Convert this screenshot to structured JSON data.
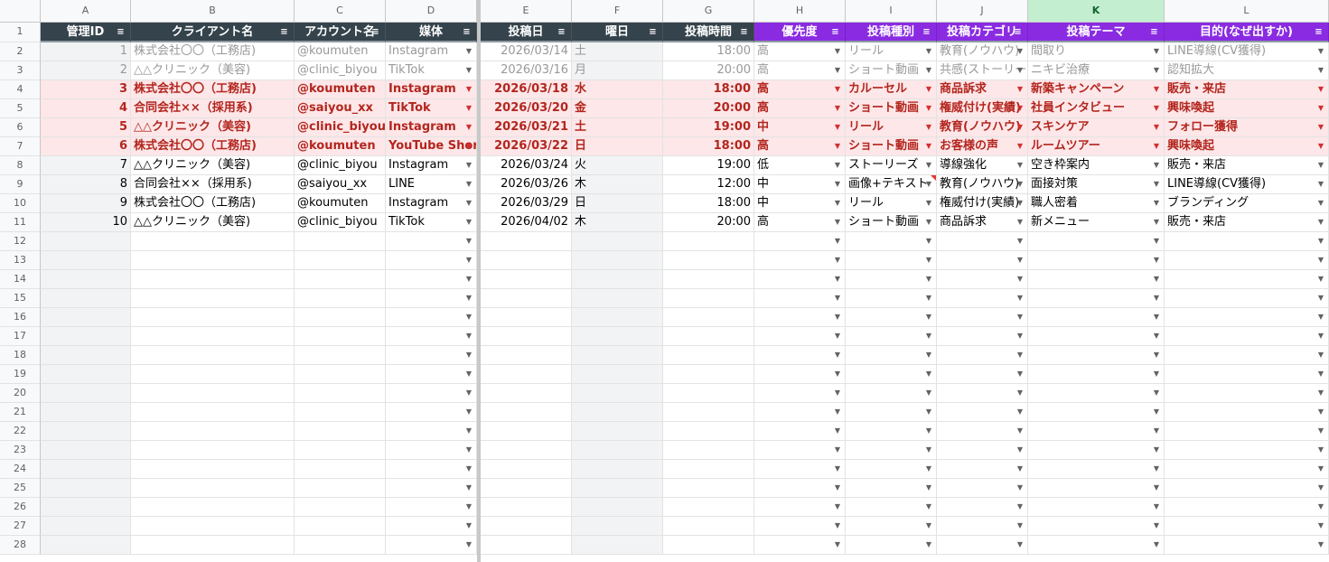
{
  "columns": [
    "A",
    "B",
    "C",
    "D",
    "E",
    "F",
    "G",
    "H",
    "I",
    "J",
    "K",
    "L"
  ],
  "headers": [
    "管理ID",
    "クライアント名",
    "アカウント名",
    "媒体",
    "投稿日",
    "曜日",
    "投稿時間",
    "優先度",
    "投稿種別",
    "投稿カテゴリ",
    "投稿テーマ",
    "目的(なぜ出すか)"
  ],
  "row_numbers": [
    "1",
    "2",
    "3",
    "4",
    "5",
    "6",
    "7",
    "8",
    "9",
    "10",
    "11",
    "12",
    "13",
    "14",
    "15",
    "16",
    "17",
    "18",
    "19",
    "20",
    "21",
    "22",
    "23",
    "24",
    "25",
    "26",
    "27",
    "28"
  ],
  "rows": [
    {
      "style": "gray",
      "cells": [
        "1",
        "株式会社〇〇（工務店)",
        "@koumuten",
        "Instagram",
        "2026/03/14",
        "土",
        "18:00",
        "高",
        "リール",
        "教育(ノウハウ)",
        "間取り",
        "LINE導線(CV獲得)"
      ]
    },
    {
      "style": "gray",
      "cells": [
        "2",
        "△△クリニック（美容)",
        "@clinic_biyou",
        "TikTok",
        "2026/03/16",
        "月",
        "20:00",
        "高",
        "ショート動画",
        "共感(ストーリー)",
        "ニキビ治療",
        "認知拡大"
      ]
    },
    {
      "style": "red",
      "cells": [
        "3",
        "株式会社〇〇（工務店)",
        "@koumuten",
        "Instagram",
        "2026/03/18",
        "水",
        "18:00",
        "高",
        "カルーセル",
        "商品訴求",
        "新築キャンペーン",
        "販売・来店"
      ]
    },
    {
      "style": "red",
      "cells": [
        "4",
        "合同会社××（採用系)",
        "@saiyou_xx",
        "TikTok",
        "2026/03/20",
        "金",
        "20:00",
        "高",
        "ショート動画",
        "権威付け(実績)",
        "社員インタビュー",
        "興味喚起"
      ]
    },
    {
      "style": "red",
      "cells": [
        "5",
        "△△クリニック（美容)",
        "@clinic_biyou",
        "Instagram",
        "2026/03/21",
        "土",
        "19:00",
        "中",
        "リール",
        "教育(ノウハウ)",
        "スキンケア",
        "フォロー獲得"
      ]
    },
    {
      "style": "red",
      "cells": [
        "6",
        "株式会社〇〇（工務店)",
        "@koumuten",
        "YouTube Shorts",
        "2026/03/22",
        "日",
        "18:00",
        "高",
        "ショート動画",
        "お客様の声",
        "ルームツアー",
        "興味喚起"
      ]
    },
    {
      "style": "normal",
      "cells": [
        "7",
        "△△クリニック（美容)",
        "@clinic_biyou",
        "Instagram",
        "2026/03/24",
        "火",
        "19:00",
        "低",
        "ストーリーズ",
        "導線強化",
        "空き枠案内",
        "販売・来店"
      ]
    },
    {
      "style": "normal",
      "cells": [
        "8",
        "合同会社××（採用系)",
        "@saiyou_xx",
        "LINE",
        "2026/03/26",
        "木",
        "12:00",
        "中",
        "画像+テキスト",
        "教育(ノウハウ)",
        "面接対策",
        "LINE導線(CV獲得)"
      ]
    },
    {
      "style": "normal",
      "cells": [
        "9",
        "株式会社〇〇（工務店)",
        "@koumuten",
        "Instagram",
        "2026/03/29",
        "日",
        "18:00",
        "中",
        "リール",
        "権威付け(実績)",
        "職人密着",
        "ブランディング"
      ]
    },
    {
      "style": "normal",
      "cells": [
        "10",
        "△△クリニック（美容)",
        "@clinic_biyou",
        "TikTok",
        "2026/04/02",
        "木",
        "20:00",
        "高",
        "ショート動画",
        "商品訴求",
        "新メニュー",
        "販売・来店"
      ]
    }
  ],
  "empty_rows": 17,
  "colors": {
    "header_dark": "#35434c",
    "header_purple": "#8a2be2",
    "highlight_red": "#b3261e",
    "highlight_bg": "#fde7e9",
    "selected_col": "#c4eed0"
  }
}
